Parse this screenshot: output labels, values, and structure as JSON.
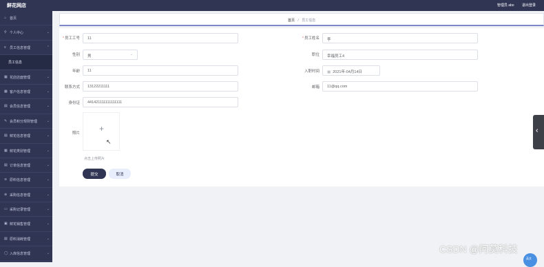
{
  "app": {
    "title": "鲜花网店"
  },
  "header": {
    "user_label": "管理员 abo",
    "logout_label": "退出登录"
  },
  "sidebar": {
    "items": [
      {
        "icon": "home-icon",
        "glyph": "⌂",
        "label": "首页",
        "chev": ""
      },
      {
        "icon": "user-icon",
        "glyph": "⚲",
        "label": "个人中心",
        "chev": "⌄"
      },
      {
        "icon": "list-icon",
        "glyph": "≡",
        "label": "员工信息管理",
        "chev": "⌃"
      },
      {
        "icon": "",
        "glyph": "",
        "label": "员工信息",
        "chev": "",
        "sub": true
      },
      {
        "icon": "grid-icon",
        "glyph": "▦",
        "label": "花店店面管理",
        "chev": "⌄"
      },
      {
        "icon": "grid-icon",
        "glyph": "▦",
        "label": "客户信息管理",
        "chev": "⌄"
      },
      {
        "icon": "doc-icon",
        "glyph": "▤",
        "label": "会员信息管理",
        "chev": "⌄"
      },
      {
        "icon": "edit-icon",
        "glyph": "✎",
        "label": "会员积分规则管理",
        "chev": "⌄"
      },
      {
        "icon": "doc-icon",
        "glyph": "▤",
        "label": "鲜花信息管理",
        "chev": "⌄"
      },
      {
        "icon": "grid-icon",
        "glyph": "▦",
        "label": "鲜花类别管理",
        "chev": "⌄"
      },
      {
        "icon": "doc-icon",
        "glyph": "▤",
        "label": "订单信息管理",
        "chev": "⌄"
      },
      {
        "icon": "doc-icon",
        "glyph": "≋",
        "label": "原料信息管理",
        "chev": "⌄"
      },
      {
        "icon": "cart-icon",
        "glyph": "⊕",
        "label": "采购信息管理",
        "chev": "⌄"
      },
      {
        "icon": "doc-icon",
        "glyph": "▭",
        "label": "采购记录管理",
        "chev": "⌄"
      },
      {
        "icon": "doc-icon",
        "glyph": "▣",
        "label": "鲜花销售管理",
        "chev": "⌄"
      },
      {
        "icon": "doc-icon",
        "glyph": "▤",
        "label": "原料消耗管理",
        "chev": "⌄"
      },
      {
        "icon": "circle-icon",
        "glyph": "◯",
        "label": "入库信息管理",
        "chev": "⌄"
      }
    ]
  },
  "breadcrumb": {
    "home": "首页",
    "sep": "/",
    "current": "员工信息"
  },
  "form": {
    "employee_no": {
      "label": "员工工号",
      "value": "11"
    },
    "employee_name": {
      "label": "员工姓名",
      "value": "李"
    },
    "gender": {
      "label": "性别",
      "value": "男"
    },
    "position": {
      "label": "职位",
      "value": "幸福员工4"
    },
    "age": {
      "label": "年龄",
      "value": "11"
    },
    "entry_date": {
      "label": "入职时间",
      "value": "2021年-04月14日"
    },
    "phone": {
      "label": "联系方式",
      "value": "13122211111"
    },
    "email": {
      "label": "邮箱",
      "value": "11@qq.com"
    },
    "id_card": {
      "label": "身份证",
      "value": "441421111111111111"
    },
    "photo": {
      "label": "照片",
      "tip": "点击上传照片"
    },
    "submit_label": "提交",
    "cancel_label": "取消"
  },
  "watermark": "CSDN @阿莫科技",
  "avatar_text": "英文"
}
